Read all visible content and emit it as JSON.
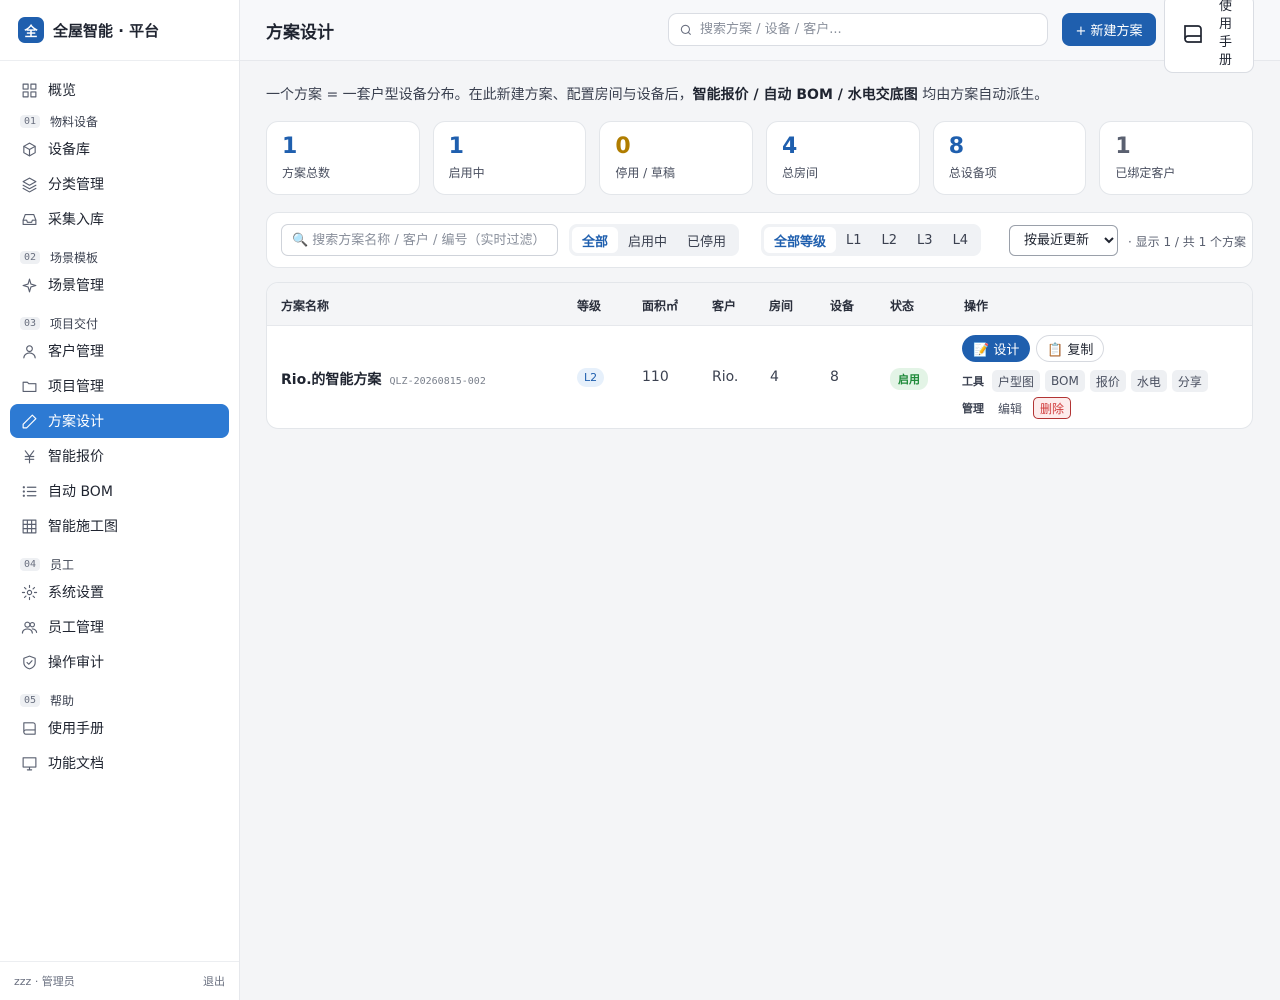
{
  "brand": {
    "logo": "全",
    "title": "全屋智能 · 平台"
  },
  "nav": {
    "overview": "概览",
    "sec1": {
      "num": "01",
      "label": "物料设备"
    },
    "device_lib": "设备库",
    "category": "分类管理",
    "collect": "采集入库",
    "sec2": {
      "num": "02",
      "label": "场景模板"
    },
    "scene": "场景管理",
    "sec3": {
      "num": "03",
      "label": "项目交付"
    },
    "customer": "客户管理",
    "project": "项目管理",
    "design": "方案设计",
    "quote": "智能报价",
    "bom": "自动 BOM",
    "drawing": "智能施工图",
    "sec4": {
      "num": "04",
      "label": "员工"
    },
    "settings": "系统设置",
    "staff": "员工管理",
    "audit": "操作审计",
    "sec5": {
      "num": "05",
      "label": "帮助"
    },
    "manual": "使用手册",
    "docs": "功能文档"
  },
  "footer": {
    "user": "zzz · 管理员",
    "logout": "退出"
  },
  "header": {
    "title": "方案设计",
    "search_placeholder": "搜索方案 / 设备 / 客户...",
    "new_label": "+ 新建方案",
    "manual_label": "使用手册"
  },
  "intro": {
    "pre": "一个方案 = 一套户型设备分布。在此新建方案、配置房间与设备后，",
    "bold": "智能报价 / 自动 BOM / 水电交底图",
    "post": " 均由方案自动派生。"
  },
  "stats": [
    {
      "value": "1",
      "label": "方案总数",
      "color": "#1f5fae"
    },
    {
      "value": "1",
      "label": "启用中",
      "color": "#1f5fae"
    },
    {
      "value": "0",
      "label": "停用 / 草稿",
      "color": "#b07d00"
    },
    {
      "value": "4",
      "label": "总房间",
      "color": "#1f5fae"
    },
    {
      "value": "8",
      "label": "总设备项",
      "color": "#1f5fae"
    },
    {
      "value": "1",
      "label": "已绑定客户",
      "color": "#5a6070"
    }
  ],
  "filter": {
    "search_placeholder": "搜索方案名称 / 客户 / 编号（实时过滤）",
    "status_opts": [
      "全部",
      "启用中",
      "已停用"
    ],
    "level_opts": [
      "全部等级",
      "L1",
      "L2",
      "L3",
      "L4"
    ],
    "sort_selected": "按最近更新",
    "count": "· 显示 1 / 共 1 个方案"
  },
  "table": {
    "headers": [
      "方案名称",
      "等级",
      "面积㎡",
      "客户",
      "房间",
      "设备",
      "状态",
      "操作"
    ],
    "rows": [
      {
        "name": "Rio.的智能方案",
        "code": "QLZ-20260815-002",
        "level": "L2",
        "area": "110",
        "customer": "Rio.",
        "rooms": "4",
        "devices": "8",
        "status": "启用"
      }
    ],
    "actions": {
      "design": "📝 设计",
      "copy": "📋 复制",
      "tools_label": "工具",
      "tools": [
        "户型图",
        "BOM",
        "报价",
        "水电",
        "分享"
      ],
      "manage_label": "管理",
      "edit": "编辑",
      "delete": "删除"
    }
  }
}
